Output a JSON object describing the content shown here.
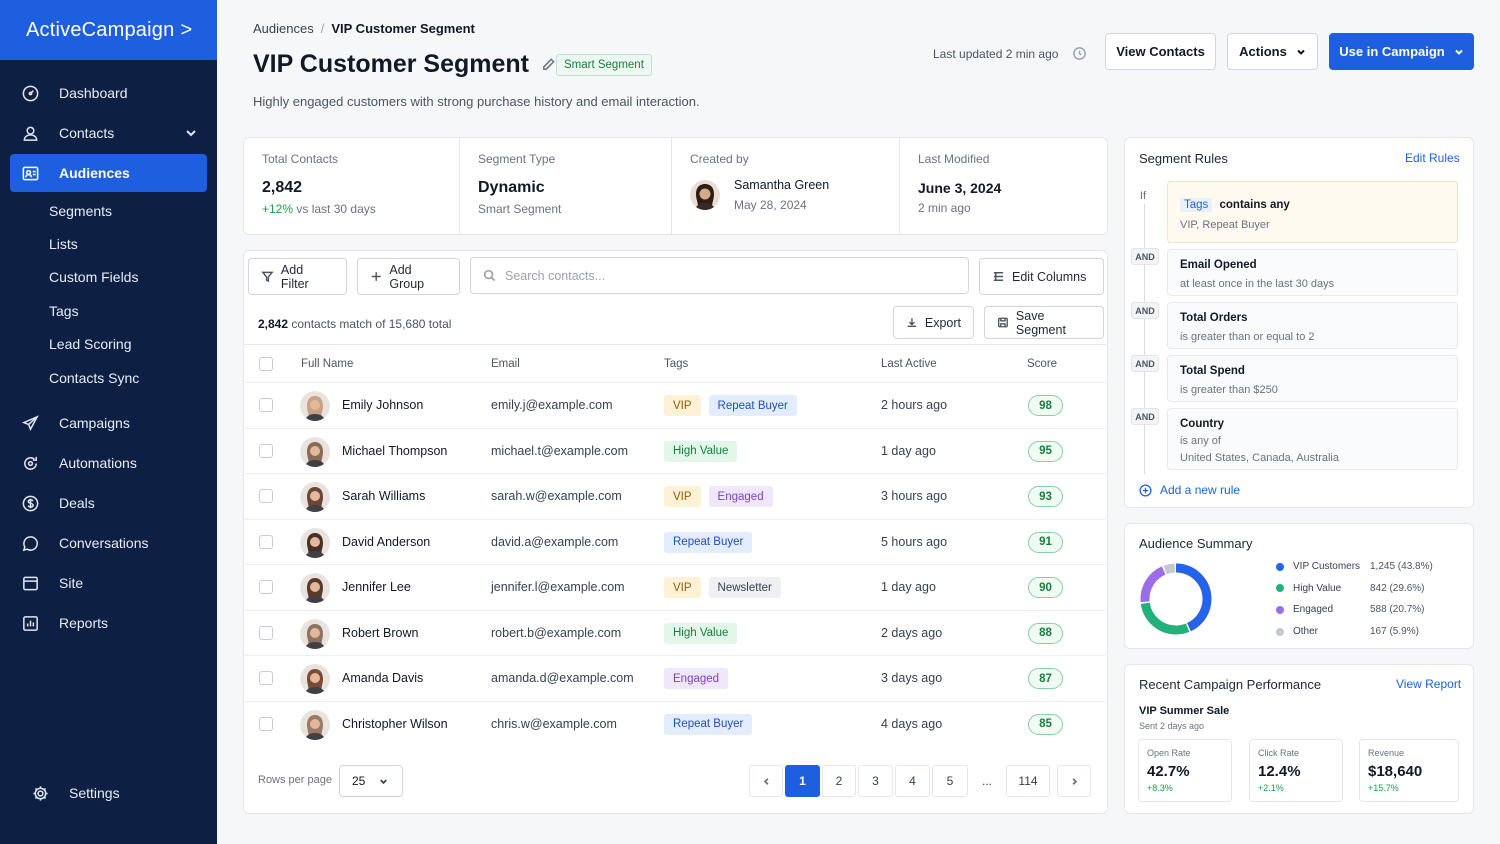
{
  "app": {
    "brand": "ActiveCampaign"
  },
  "nav": {
    "dashboard": "Dashboard",
    "contacts": "Contacts",
    "audiences": "Audiences",
    "sub": [
      "Segments",
      "Lists",
      "Custom Fields",
      "Tags",
      "Lead Scoring",
      "Contacts Sync"
    ],
    "campaigns": "Campaigns",
    "automations": "Automations",
    "deals": "Deals",
    "conversations": "Conversations",
    "site": "Site",
    "reports": "Reports",
    "settings": "Settings"
  },
  "header": {
    "breadcrumb_root": "Audiences",
    "breadcrumb_sep": "/",
    "breadcrumb_current": "VIP Customer Segment",
    "title": "VIP Customer Segment",
    "badge": "Smart Segment",
    "subtitle": "Highly engaged customers with strong purchase history and email interaction.",
    "last_updated": "Last updated 2 min ago",
    "view_contacts": "View Contacts",
    "actions": "Actions",
    "use_in_campaign": "Use in Campaign"
  },
  "stats": {
    "total_label": "Total Contacts",
    "total_value": "2,842",
    "total_change": "+12%",
    "total_change_suffix": "vs last 30 days",
    "type_label": "Segment Type",
    "type_value": "Dynamic",
    "type_sub": "Smart Segment",
    "created_label": "Created by",
    "created_name": "Samantha Green",
    "created_date": "May 28, 2024",
    "modified_label": "Last Modified",
    "modified_value": "June 3, 2024",
    "modified_sub": "2 min ago"
  },
  "toolbar": {
    "add_filter": "Add Filter",
    "add_group": "Add Group",
    "search_placeholder": "Search contacts...",
    "edit_columns": "Edit Columns",
    "match_count": "2,842",
    "match_text": "contacts match of 15,680 total",
    "export": "Export",
    "save_segment": "Save Segment"
  },
  "table": {
    "columns": [
      "Full Name",
      "Email",
      "Tags",
      "Last Active",
      "Score"
    ],
    "rows": [
      {
        "name": "Emily Johnson",
        "email": "emily.j@example.com",
        "tags": [
          "VIP",
          "Repeat Buyer"
        ],
        "last_active": "2 hours ago",
        "score": "98"
      },
      {
        "name": "Michael Thompson",
        "email": "michael.t@example.com",
        "tags": [
          "High Value"
        ],
        "last_active": "1 day ago",
        "score": "95"
      },
      {
        "name": "Sarah Williams",
        "email": "sarah.w@example.com",
        "tags": [
          "VIP",
          "Engaged"
        ],
        "last_active": "3 hours ago",
        "score": "93"
      },
      {
        "name": "David Anderson",
        "email": "david.a@example.com",
        "tags": [
          "Repeat Buyer"
        ],
        "last_active": "5 hours ago",
        "score": "91"
      },
      {
        "name": "Jennifer Lee",
        "email": "jennifer.l@example.com",
        "tags": [
          "VIP",
          "Newsletter"
        ],
        "last_active": "1 day ago",
        "score": "90"
      },
      {
        "name": "Robert Brown",
        "email": "robert.b@example.com",
        "tags": [
          "High Value"
        ],
        "last_active": "2 days ago",
        "score": "88"
      },
      {
        "name": "Amanda Davis",
        "email": "amanda.d@example.com",
        "tags": [
          "Engaged"
        ],
        "last_active": "3 days ago",
        "score": "87"
      },
      {
        "name": "Christopher Wilson",
        "email": "chris.w@example.com",
        "tags": [
          "Repeat Buyer"
        ],
        "last_active": "4 days ago",
        "score": "85"
      }
    ],
    "tag_colors": {
      "VIP": {
        "bg": "#fdf1d6",
        "fg": "#9a5b00"
      },
      "Repeat Buyer": {
        "bg": "#e4edfd",
        "fg": "#1d4fc4"
      },
      "High Value": {
        "bg": "#e3f6ea",
        "fg": "#15803d"
      },
      "Engaged": {
        "bg": "#efe7fb",
        "fg": "#7e3fc8"
      },
      "Newsletter": {
        "bg": "#eef0f3",
        "fg": "#374151"
      }
    },
    "avatar_colors": [
      "#c9a184",
      "#8a6a55",
      "#6b4634",
      "#4a3024",
      "#5b3a2a",
      "#8f7362",
      "#7a4a34",
      "#9a7a64"
    ]
  },
  "pagination": {
    "rows_label": "Rows per page",
    "rows_value": "25",
    "pages": [
      "1",
      "2",
      "3",
      "4",
      "5"
    ],
    "ellipsis": "...",
    "last": "114"
  },
  "rules": {
    "title": "Segment Rules",
    "edit": "Edit Rules",
    "if": "If",
    "and": "AND",
    "first_field": "Tags",
    "first_op": "contains any",
    "first_value": "VIP, Repeat Buyer",
    "items": [
      {
        "title": "Email Opened",
        "desc": "at least once in the last 30 days"
      },
      {
        "title": "Total Orders",
        "desc": "is greater than or equal to 2"
      },
      {
        "title": "Total Spend",
        "desc": "is greater than $250"
      },
      {
        "title": "Country",
        "desc": "is any of",
        "desc2": "United States, Canada, Australia"
      }
    ],
    "add": "Add a new rule"
  },
  "summary": {
    "title": "Audience Summary",
    "items": [
      {
        "label": "VIP Customers",
        "value": "1,245 (43.8%)",
        "pct": 43.8,
        "color": "#2563eb"
      },
      {
        "label": "High Value",
        "value": "842 (29.6%)",
        "pct": 29.6,
        "color": "#22b07d"
      },
      {
        "label": "Engaged",
        "value": "588 (20.7%)",
        "pct": 20.7,
        "color": "#9b6ee8"
      },
      {
        "label": "Other",
        "value": "167 (5.9%)",
        "pct": 5.9,
        "color": "#c4c8cf"
      }
    ]
  },
  "campaign": {
    "title": "Recent Campaign Performance",
    "link": "View Report",
    "name": "VIP Summer Sale",
    "sent": "Sent 2 days ago",
    "metrics": [
      {
        "label": "Open Rate",
        "value": "42.7%",
        "delta": "+8.3%"
      },
      {
        "label": "Click Rate",
        "value": "12.4%",
        "delta": "+2.1%"
      },
      {
        "label": "Revenue",
        "value": "$18,640",
        "delta": "+15.7%"
      }
    ]
  }
}
